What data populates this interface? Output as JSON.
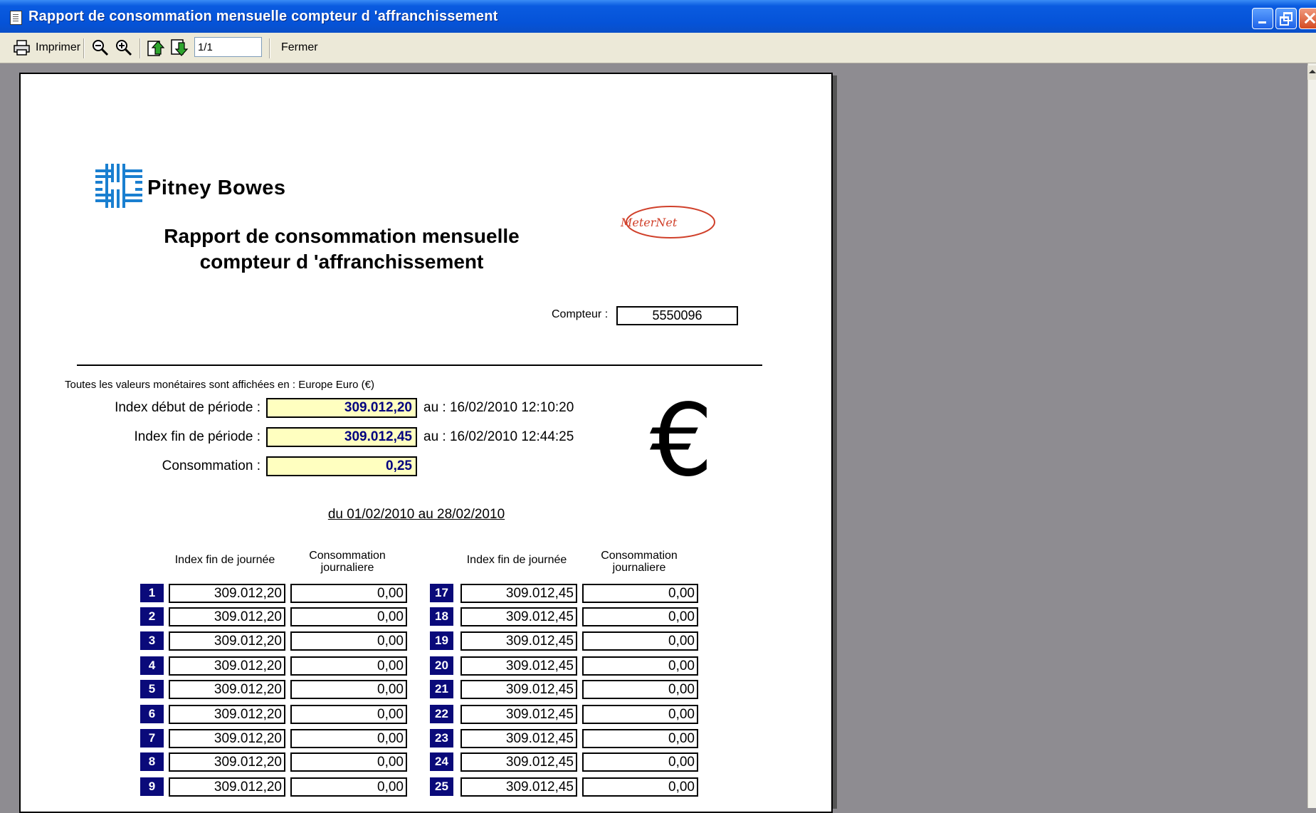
{
  "window": {
    "title": "Rapport de consommation mensuelle compteur d 'affranchissement"
  },
  "toolbar": {
    "print_label": "Imprimer",
    "page_indicator": "1/1",
    "close_label": "Fermer"
  },
  "report": {
    "brand": "Pitney Bowes",
    "title_line1": "Rapport de consommation mensuelle",
    "title_line2": "compteur d 'affranchissement",
    "meternet_logo": "MeterNet",
    "compteur_label": "Compteur :",
    "compteur_value": "5550096",
    "currency_note": "Toutes les valeurs monétaires sont affichées en : Europe Euro (€)",
    "index_debut_label": "Index début de période :",
    "index_debut_value": "309.012,20",
    "index_debut_au": "au :  16/02/2010 12:10:20",
    "index_fin_label": "Index fin de période :",
    "index_fin_value": "309.012,45",
    "index_fin_au": "au :  16/02/2010 12:44:25",
    "consommation_label": "Consommation :",
    "consommation_value": "0,25",
    "currency_symbol": "€",
    "period": "du 01/02/2010  au 28/02/2010",
    "col_index": "Index fin de journée",
    "col_conso_line1": "Consommation",
    "col_conso_line2": "journaliere"
  },
  "days_left": [
    {
      "day": "1",
      "index": "309.012,20",
      "conso": "0,00"
    },
    {
      "day": "2",
      "index": "309.012,20",
      "conso": "0,00"
    },
    {
      "day": "3",
      "index": "309.012,20",
      "conso": "0,00"
    },
    {
      "day": "4",
      "index": "309.012,20",
      "conso": "0,00"
    },
    {
      "day": "5",
      "index": "309.012,20",
      "conso": "0,00"
    },
    {
      "day": "6",
      "index": "309.012,20",
      "conso": "0,00"
    },
    {
      "day": "7",
      "index": "309.012,20",
      "conso": "0,00"
    },
    {
      "day": "8",
      "index": "309.012,20",
      "conso": "0,00"
    },
    {
      "day": "9",
      "index": "309.012,20",
      "conso": "0,00"
    }
  ],
  "days_right": [
    {
      "day": "17",
      "index": "309.012,45",
      "conso": "0,00"
    },
    {
      "day": "18",
      "index": "309.012,45",
      "conso": "0,00"
    },
    {
      "day": "19",
      "index": "309.012,45",
      "conso": "0,00"
    },
    {
      "day": "20",
      "index": "309.012,45",
      "conso": "0,00"
    },
    {
      "day": "21",
      "index": "309.012,45",
      "conso": "0,00"
    },
    {
      "day": "22",
      "index": "309.012,45",
      "conso": "0,00"
    },
    {
      "day": "23",
      "index": "309.012,45",
      "conso": "0,00"
    },
    {
      "day": "24",
      "index": "309.012,45",
      "conso": "0,00"
    },
    {
      "day": "25",
      "index": "309.012,45",
      "conso": "0,00"
    }
  ],
  "colors": {
    "day_badge": "#0a0a7a",
    "highlight_field": "#ffffc0",
    "highlight_text": "#00007f",
    "titlebar": "#0553d8",
    "brand_blue": "#1a7fd0"
  }
}
